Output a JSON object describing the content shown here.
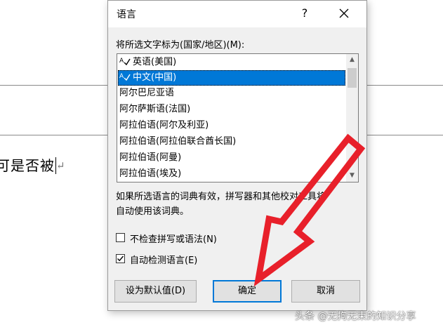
{
  "document": {
    "text_fragment": "是否被",
    "cut_glyph": "可",
    "paragraph_mark": "↵"
  },
  "dialog": {
    "title": "语言",
    "help_label": "?",
    "mark_label": "将所选文字标为(国家/地区)(M):",
    "languages": [
      {
        "label": "英语(美国)",
        "has_spell_icon": true,
        "selected": false
      },
      {
        "label": "中文(中国)",
        "has_spell_icon": true,
        "selected": true
      },
      {
        "label": "阿尔巴尼亚语",
        "has_spell_icon": false,
        "selected": false
      },
      {
        "label": "阿尔萨斯语(法国)",
        "has_spell_icon": false,
        "selected": false
      },
      {
        "label": "阿拉伯语(阿尔及利亚)",
        "has_spell_icon": false,
        "selected": false
      },
      {
        "label": "阿拉伯语(阿拉伯联合酋长国)",
        "has_spell_icon": false,
        "selected": false
      },
      {
        "label": "阿拉伯语(阿曼)",
        "has_spell_icon": false,
        "selected": false
      },
      {
        "label": "阿拉伯语(埃及)",
        "has_spell_icon": false,
        "selected": false
      }
    ],
    "info_line1": "如果所选语言的词典有效，拼写器和其他校对工具将",
    "info_line2": "自动使用该词典。",
    "no_proof_label": "不检查拼写或语法(N)",
    "no_proof_checked": false,
    "auto_detect_label": "自动检测语言(E)",
    "auto_detect_checked": true,
    "buttons": {
      "set_default": "设为默认值(D)",
      "ok": "确定",
      "cancel": "取消"
    }
  },
  "watermark": "头条 @无拘无束的知识分享",
  "colors": {
    "selection": "#0078d7",
    "arrow": "#e8202a",
    "dialog_bg": "#f0f0f0"
  }
}
